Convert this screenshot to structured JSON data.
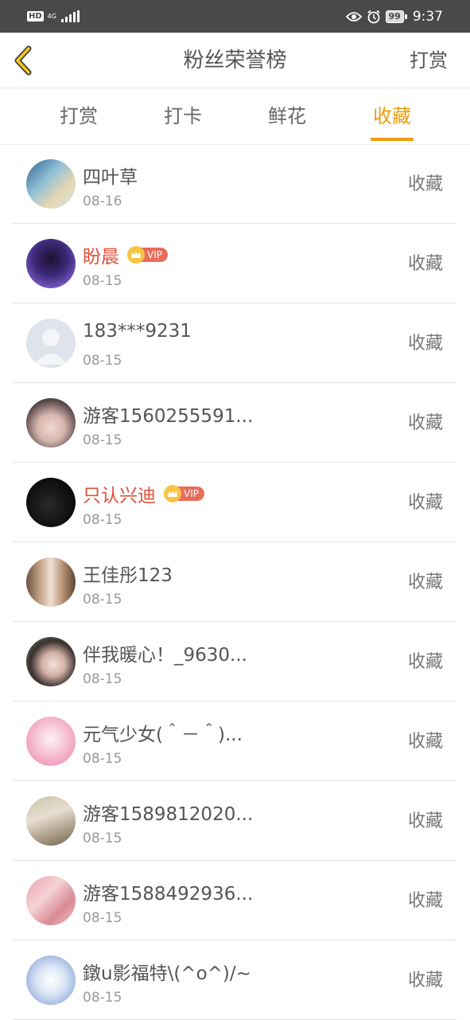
{
  "status_bar": {
    "hd_label": "HD",
    "network_label": "4G",
    "battery_level": "99",
    "time": "9:37"
  },
  "header": {
    "title": "粉丝荣誉榜",
    "right_action": "打赏"
  },
  "tabs": [
    {
      "label": "打赏",
      "active": false
    },
    {
      "label": "打卡",
      "active": false
    },
    {
      "label": "鲜花",
      "active": false
    },
    {
      "label": "收藏",
      "active": true
    }
  ],
  "colors": {
    "accent": "#ef9d0d",
    "vip_name": "#e1503b",
    "status_bar_bg": "#494949"
  },
  "vip_label": "VIP",
  "fans": [
    {
      "name": "四叶草",
      "date": "08-16",
      "action": "收藏",
      "vip": false
    },
    {
      "name": "盼晨",
      "date": "08-15",
      "action": "收藏",
      "vip": true
    },
    {
      "name": "183***9231",
      "date": "08-15",
      "action": "收藏",
      "vip": false
    },
    {
      "name": "游客1560255591...",
      "date": "08-15",
      "action": "收藏",
      "vip": false
    },
    {
      "name": "只认兴迪",
      "date": "08-15",
      "action": "收藏",
      "vip": true
    },
    {
      "name": "王佳彤123",
      "date": "08-15",
      "action": "收藏",
      "vip": false
    },
    {
      "name": "伴我暖心！_9630...",
      "date": "08-15",
      "action": "收藏",
      "vip": false
    },
    {
      "name": "元气少女(＾－＾)...",
      "date": "08-15",
      "action": "收藏",
      "vip": false
    },
    {
      "name": "游客1589812020...",
      "date": "08-15",
      "action": "收藏",
      "vip": false
    },
    {
      "name": "游客1588492936...",
      "date": "08-15",
      "action": "收藏",
      "vip": false
    },
    {
      "name": "鐓u影福特\\(^o^)/~",
      "date": "08-15",
      "action": "收藏",
      "vip": false
    }
  ]
}
